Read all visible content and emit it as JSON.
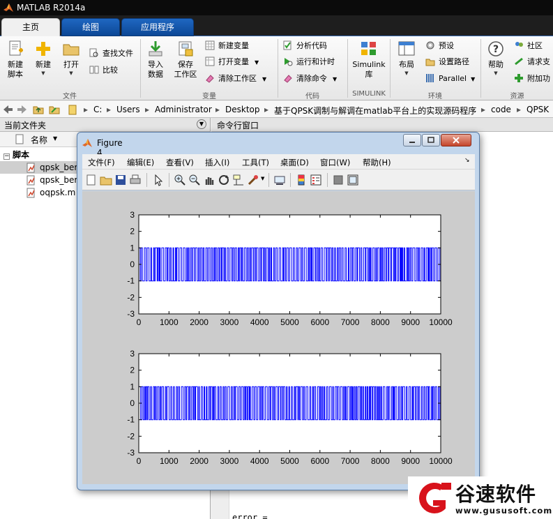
{
  "app": {
    "title": "MATLAB R2014a"
  },
  "tabs": [
    {
      "label": "主页"
    },
    {
      "label": "绘图"
    },
    {
      "label": "应用程序"
    }
  ],
  "ribbon": {
    "file": {
      "new_script": "新建\n脚本",
      "new": "新建",
      "open": "打开",
      "find_files": "查找文件",
      "compare": "比较",
      "group": "文件"
    },
    "variable": {
      "import_data": "导入\n数据",
      "save_workspace": "保存\n工作区",
      "new_variable": "新建变量",
      "open_variable": "打开变量",
      "clear_workspace": "清除工作区",
      "group": "变量"
    },
    "code": {
      "analyze_code": "分析代码",
      "run_and_time": "运行和计时",
      "clear_commands": "清除命令",
      "group": "代码"
    },
    "simulink": {
      "label": "Simulink\n库",
      "group": "SIMULINK"
    },
    "environment": {
      "layout": "布局",
      "preferences": "预设",
      "set_path": "设置路径",
      "parallel": "Parallel",
      "group": "环境"
    },
    "resources": {
      "help": "帮助",
      "community": "社区",
      "request_support": "请求支",
      "add_ons": "附加功",
      "group": "资源"
    }
  },
  "address": {
    "crumbs": [
      "C:",
      "Users",
      "Administrator",
      "Desktop",
      "基于QPSK调制与解调在matlab平台上的实现源码程序",
      "code",
      "QPSK"
    ]
  },
  "current_folder": {
    "title": "当前文件夹",
    "col_name": "名称",
    "group": "脚本",
    "files": [
      "qpsk_ber",
      "qpsk_ber",
      "oqpsk.m"
    ]
  },
  "command_window": {
    "title": "命令行窗口",
    "output": "error ="
  },
  "figure": {
    "title": "Figure 4",
    "menu": [
      "文件(F)",
      "编辑(E)",
      "查看(V)",
      "插入(I)",
      "工具(T)",
      "桌面(D)",
      "窗口(W)",
      "帮助(H)"
    ],
    "tool_icons": [
      "new-figure-icon",
      "open-file-icon",
      "save-icon",
      "print-icon",
      "pointer-icon",
      "zoom-in-icon",
      "zoom-out-icon",
      "pan-icon",
      "rotate-icon",
      "data-cursor-icon",
      "brush-icon",
      "link-icon",
      "colorbar-icon",
      "legend-icon",
      "hide-tools-icon",
      "show-tools-icon"
    ],
    "line_color": "#0000ff"
  },
  "chart_data": [
    {
      "type": "line",
      "title": "",
      "xlabel": "",
      "ylabel": "",
      "xlim": [
        0,
        10000
      ],
      "ylim": [
        -3,
        3
      ],
      "xticks": [
        0,
        1000,
        2000,
        3000,
        4000,
        5000,
        6000,
        7000,
        8000,
        9000,
        10000
      ],
      "yticks": [
        3,
        2,
        1,
        0,
        -1,
        -2,
        -3
      ],
      "series": [
        {
          "levels": [
            -1,
            1
          ],
          "color": "#0000ff"
        }
      ]
    },
    {
      "type": "line",
      "title": "",
      "xlabel": "",
      "ylabel": "",
      "xlim": [
        0,
        10000
      ],
      "ylim": [
        -3,
        3
      ],
      "xticks": [
        0,
        1000,
        2000,
        3000,
        4000,
        5000,
        6000,
        7000,
        8000,
        9000,
        10000
      ],
      "yticks": [
        3,
        2,
        1,
        0,
        -1,
        -2,
        -3
      ],
      "series": [
        {
          "levels": [
            -1,
            1
          ],
          "color": "#0000ff"
        }
      ]
    }
  ],
  "watermark": {
    "text": "谷速软件",
    "url": "www.gususoft.com"
  }
}
